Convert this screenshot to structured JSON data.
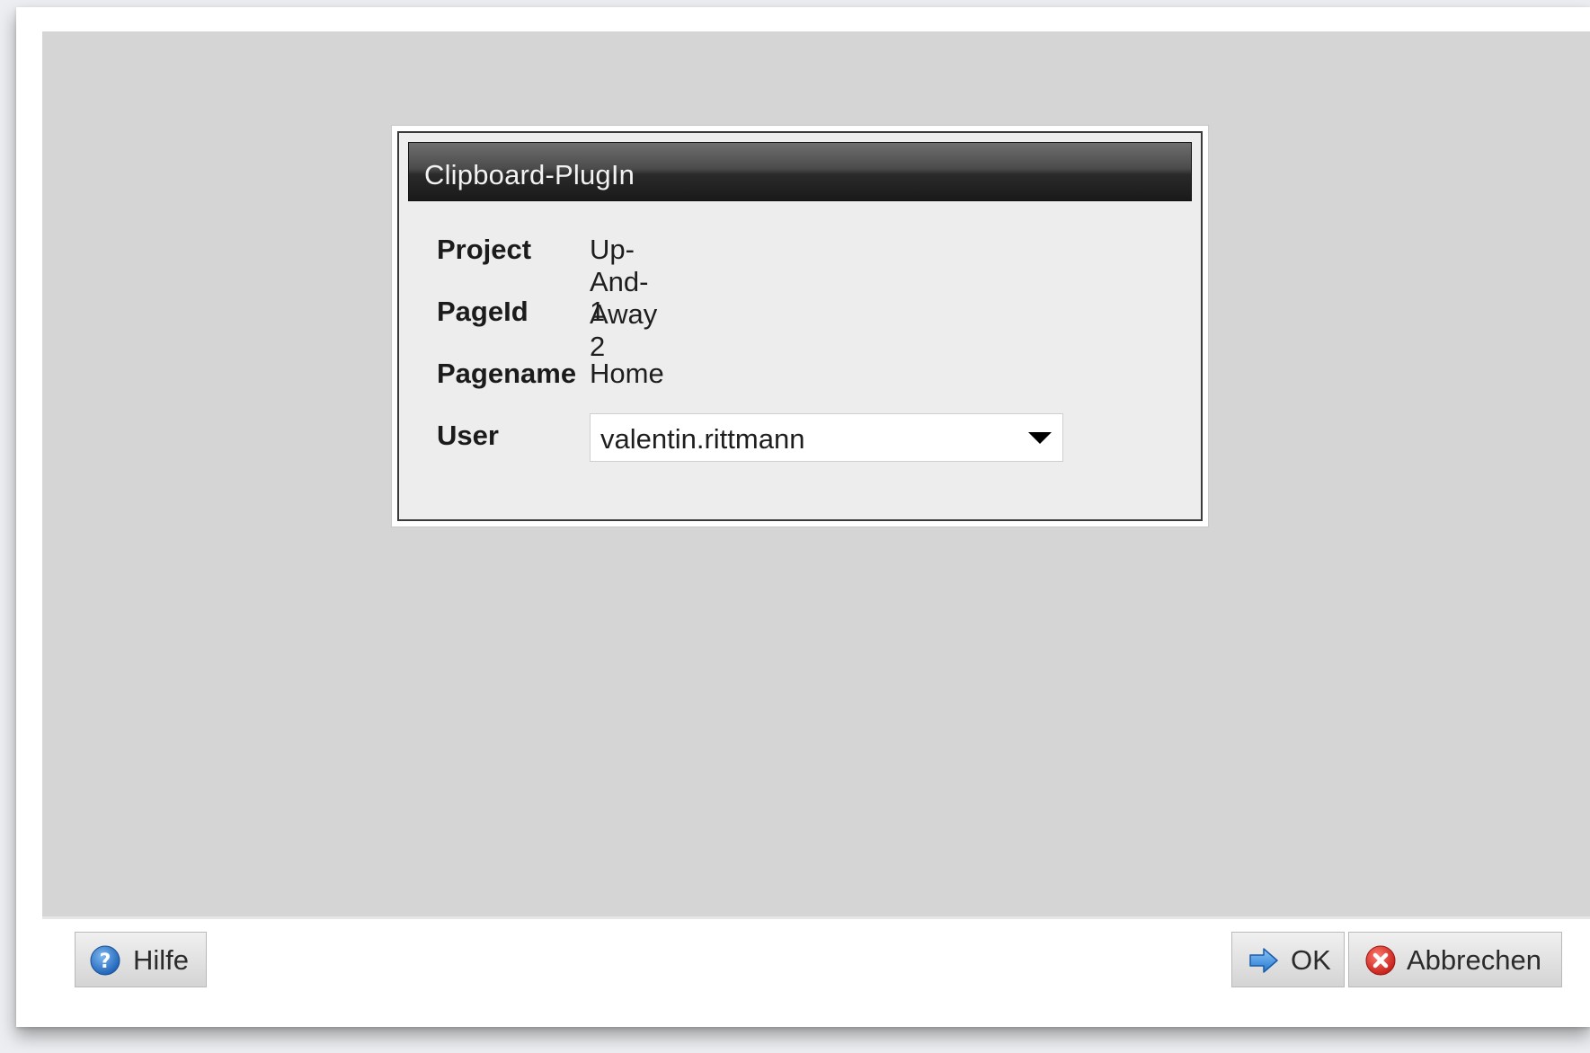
{
  "plugin": {
    "title": "Clipboard-PlugIn",
    "project_label": "Project",
    "project_value": "Up-And-Away 2",
    "pageid_label": "PageId",
    "pageid_value": "1",
    "pagename_label": "Pagename",
    "pagename_value": "Home",
    "user_label": "User",
    "user_value": "valentin.rittmann"
  },
  "footer": {
    "help_label": "Hilfe",
    "ok_label": "OK",
    "cancel_label": "Abbrechen"
  },
  "icons": {
    "help": "help-icon",
    "ok": "arrow-right-icon",
    "cancel": "cancel-icon",
    "dropdown": "chevron-down-icon"
  },
  "colors": {
    "header_dark": "#1a1a1a",
    "help_blue": "#2f7fd4",
    "ok_blue": "#2d8be6",
    "cancel_red": "#e3372b"
  }
}
